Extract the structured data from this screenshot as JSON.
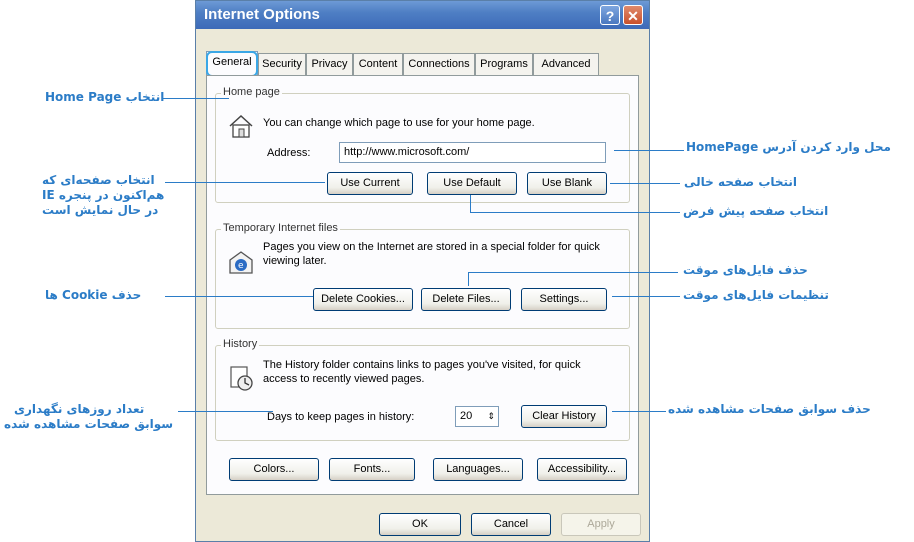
{
  "window": {
    "title": "Internet Options",
    "help_glyph": "?",
    "close_glyph": "✕"
  },
  "tabs": [
    "General",
    "Security",
    "Privacy",
    "Content",
    "Connections",
    "Programs",
    "Advanced"
  ],
  "home": {
    "group_label": "Home page",
    "description": "You can change which page to use for your home page.",
    "address_label": "Address:",
    "address_value": "http://www.microsoft.com/",
    "btn_current": "Use Current",
    "btn_default": "Use Default",
    "btn_blank": "Use Blank"
  },
  "temp": {
    "group_label": "Temporary Internet files",
    "description": "Pages you view on the Internet are stored in a special folder for quick viewing later.",
    "btn_cookies": "Delete Cookies...",
    "btn_files": "Delete Files...",
    "btn_settings": "Settings..."
  },
  "history": {
    "group_label": "History",
    "description": "The History folder contains links to pages you've visited, for quick access to recently viewed pages.",
    "days_label": "Days to keep pages in history:",
    "days_value": "20",
    "btn_clear": "Clear History"
  },
  "bottom_buttons": {
    "colors": "Colors...",
    "fonts": "Fonts...",
    "languages": "Languages...",
    "accessibility": "Accessibility..."
  },
  "dialog_buttons": {
    "ok": "OK",
    "cancel": "Cancel",
    "apply": "Apply"
  },
  "annotations": {
    "select_home": "انتخاب Home Page",
    "address_entry": "محل وارد کردن آدرس HomePage",
    "current_page_1": "انتخاب صفحه‌ای که",
    "current_page_2": "هم‌اکنون در پنجره IE",
    "current_page_3": "در حال نمایش است",
    "blank_page": "انتخاب صفحه خالی",
    "default_page": "انتخاب صفحه پیش فرض",
    "delete_temp": "حذف فایل‌های موقت",
    "delete_cookies": "حذف Cookie ها",
    "temp_settings": "تنظیمات فایل‌های موقت",
    "days_1": "تعداد روزهای نگهداری",
    "days_2": "سوابق صفحات مشاهده شده",
    "clear_history": "حذف سوابق صفحات مشاهده شده"
  },
  "colors": {
    "annotation": "#2b7cc7",
    "titlebar": "#4f7fc4",
    "dialog_bg": "#ece9d8"
  }
}
